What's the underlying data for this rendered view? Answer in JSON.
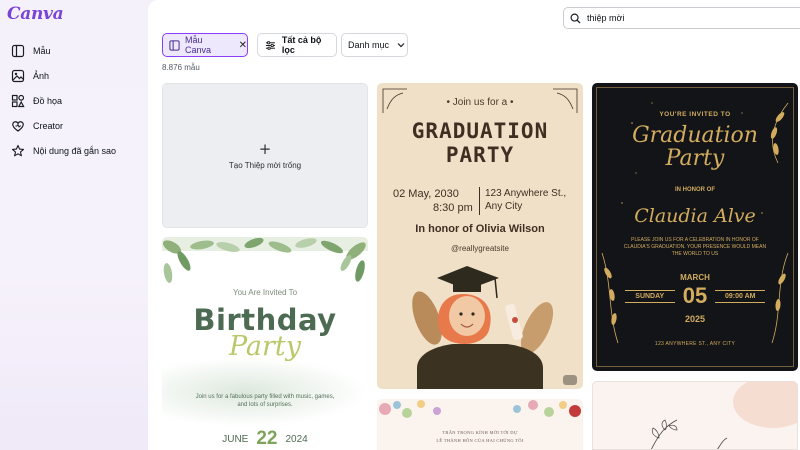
{
  "app": {
    "logo": "Canva"
  },
  "sidebar": {
    "items": [
      {
        "label": "Mẫu",
        "icon": "template-icon"
      },
      {
        "label": "Ảnh",
        "icon": "image-icon"
      },
      {
        "label": "Đồ họa",
        "icon": "shapes-icon"
      },
      {
        "label": "Creator",
        "icon": "heart-icon"
      },
      {
        "label": "Nội dung đã gắn sao",
        "icon": "star-icon"
      }
    ]
  },
  "search": {
    "value": "thiệp mời",
    "placeholder": ""
  },
  "filters": {
    "active_chip": "Mẫu Canva",
    "all_filters": "Tất cả bộ lọc",
    "category": "Danh mục"
  },
  "results": {
    "count": "8.876 mẫu"
  },
  "cards": {
    "blank": {
      "plus": "+",
      "label": "Tạo Thiệp mời trống"
    },
    "birthday": {
      "invite": "You Are Invited To",
      "title": "Birthday",
      "subtitle": "Party",
      "body": "Join us for a fabulous party filled with music, games, and lots of surprises.",
      "month": "JUNE",
      "day": "22",
      "year": "2024"
    },
    "graduation": {
      "join": "• Join us for a •",
      "title_line1": "GRADUATION",
      "title_line2": "PARTY",
      "date_line1": "02 May, 2030",
      "date_line2": "8:30 pm",
      "address_line1": "123 Anywhere St.,",
      "address_line2": "Any City",
      "honor": "In honor of Olivia Wilson",
      "handle": "@reallygreatsite"
    },
    "floral": {
      "line1": "TRÂN TRỌNG KÍNH MỜI TỚI DỰ",
      "line2": "LỄ THÀNH HÔN CỦA HAI CHÚNG TÔI"
    },
    "black_gold": {
      "invited": "YOU'RE INVITED TO",
      "title_line1": "Graduation",
      "title_line2": "Party",
      "honor": "IN HONOR OF",
      "name": "Claudia Alve",
      "body": "PLEASE JOIN US FOR A CELEBRATION IN HONOR OF CLAUDIA'S GRADUATION. YOUR PRESENCE WOULD MEAN THE WORLD TO US",
      "month": "MARCH",
      "weekday": "SUNDAY",
      "day": "05",
      "time": "09:00 AM",
      "year": "2025",
      "address": "123 ANYWHERE ST., ANY CITY"
    }
  },
  "colors": {
    "accent": "#8b3dff",
    "logo": "#7a43d8",
    "sidebar_bg": "#f4f1fb",
    "gold": "#d3ac5e",
    "grad_bg": "#f1e0c8"
  }
}
